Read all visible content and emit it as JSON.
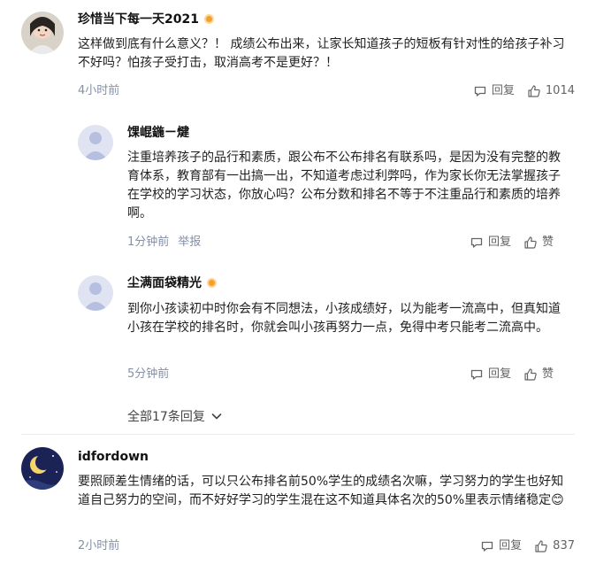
{
  "comments": [
    {
      "username": "珍惜当下每一天2021",
      "text": "这样做到底有什么意义？！ 成绩公布出来，让家长知道孩子的短板有针对性的给孩子补习不好吗？怕孩子受打击，取消高考不是更好？！",
      "time": "4小时前",
      "reply_label": "回复",
      "like_count": "1014",
      "replies": [
        {
          "username": "馃崐鍦ㄧ煡",
          "text": "注重培养孩子的品行和素质，跟公布不公布排名有联系吗，是因为没有完整的教育体系，教育部有一出搞一出，不知道考虑过利弊吗，作为家长你无法掌握孩子在学校的学习状态，你放心吗？公布分数和排名不等于不注重品行和素质的培养啊。",
          "time": "1分钟前",
          "report_label": "举报",
          "reply_label": "回复",
          "like_label": "赞"
        },
        {
          "username": "尘满面袋精光",
          "text": "到你小孩读初中时你会有不同想法，小孩成绩好，以为能考一流高中，但真知道小孩在学校的排名时，你就会叫小孩再努力一点，免得中考只能考二流高中。",
          "time": "5分钟前",
          "reply_label": "回复",
          "like_label": "赞"
        }
      ],
      "expand_label": "全部17条回复"
    },
    {
      "username": "idfordown",
      "text": "要照顾差生情绪的话，可以只公布排名前50%学生的成绩名次嘛，学习努力的学生也好知道自己努力的空间，而不好好学习的学生混在这不知道具体名次的50%里表示情绪稳定",
      "emoji": "😊",
      "time": "2小时前",
      "reply_label": "回复",
      "like_count": "837"
    }
  ],
  "colors": {
    "meta": "#8590a6",
    "badge": "#f0a030",
    "text": "#1f1f1f"
  },
  "icons": [
    "reply-icon",
    "like-icon",
    "chevron-down-icon",
    "badge-icon"
  ]
}
